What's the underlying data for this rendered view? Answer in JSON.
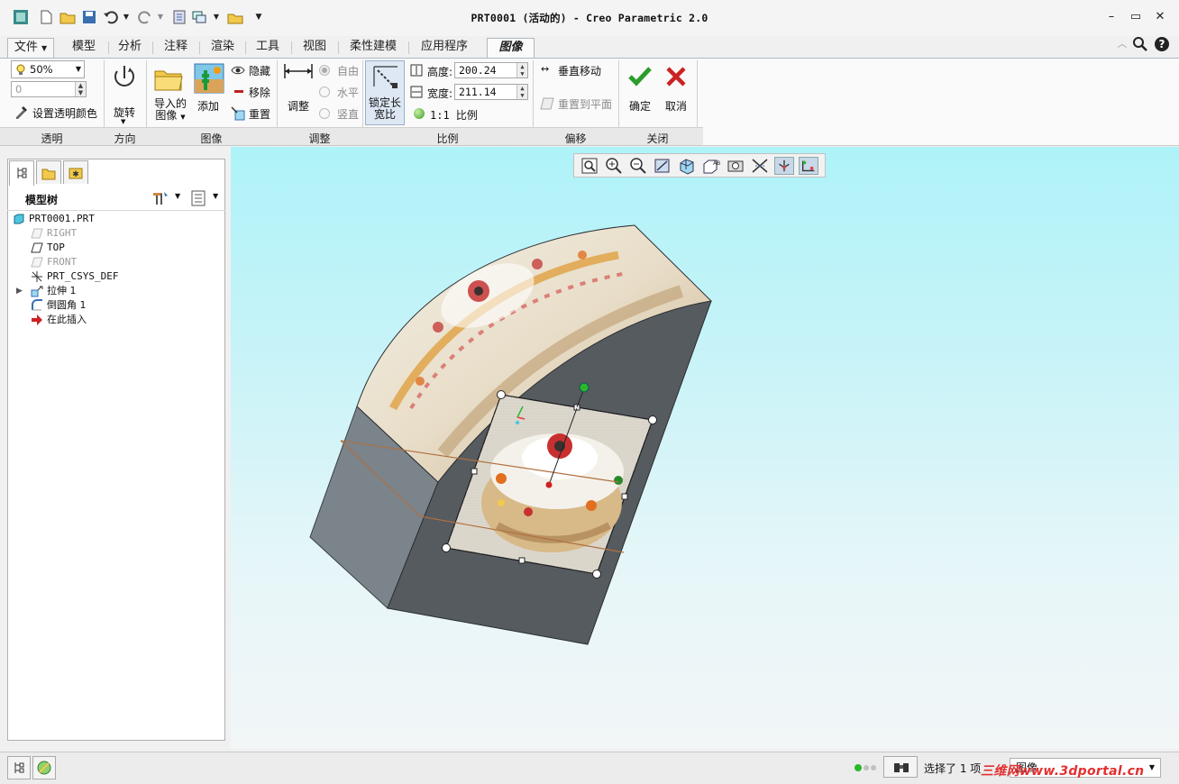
{
  "window": {
    "title": "PRT0001 (活动的) - Creo Parametric 2.0"
  },
  "tabs": [
    {
      "label": "文件"
    },
    {
      "label": "模型"
    },
    {
      "label": "分析"
    },
    {
      "label": "注释"
    },
    {
      "label": "渲染"
    },
    {
      "label": "工具"
    },
    {
      "label": "视图"
    },
    {
      "label": "柔性建模"
    },
    {
      "label": "应用程序"
    },
    {
      "label": "图像"
    }
  ],
  "active_tab": "图像",
  "ribbon": {
    "transparency": {
      "value": "50%",
      "number_field": "0",
      "set_color_label": "设置透明颜色",
      "group_label": "透明"
    },
    "orientation": {
      "rotate_label": "旋转",
      "group_label": "方向"
    },
    "image": {
      "imported_label_line1": "导入的",
      "imported_label_line2": "图像",
      "add_label": "添加",
      "hide_label": "隐藏",
      "remove_label": "移除",
      "reset_label": "重置",
      "group_label": "图像"
    },
    "adjust": {
      "adjust_label": "调整",
      "free_label": "自由",
      "horizontal_label": "水平",
      "vertical_label": "竖直",
      "group_label": "调整"
    },
    "scale": {
      "lock_label_line1": "锁定长",
      "lock_label_line2": "宽比",
      "height_label": "高度:",
      "height_value": "200.24",
      "width_label": "宽度:",
      "width_value": "211.14",
      "ratio_label": "1:1 比例",
      "group_label": "比例"
    },
    "offset": {
      "vertical_move_label": "垂直移动",
      "reset_to_plane_label": "重置到平面",
      "group_label": "偏移"
    },
    "close": {
      "ok_label": "确定",
      "cancel_label": "取消",
      "group_label": "关闭"
    }
  },
  "model_tree": {
    "title": "模型树",
    "items": [
      {
        "label": "PRT0001.PRT",
        "icon": "part-icon",
        "dim": false
      },
      {
        "label": "RIGHT",
        "icon": "datum-plane-icon",
        "dim": true
      },
      {
        "label": "TOP",
        "icon": "datum-plane-icon",
        "dim": false
      },
      {
        "label": "FRONT",
        "icon": "datum-plane-icon",
        "dim": true
      },
      {
        "label": "PRT_CSYS_DEF",
        "icon": "csys-icon",
        "dim": false
      },
      {
        "label": "拉伸 1",
        "icon": "extrude-icon",
        "dim": false
      },
      {
        "label": "倒圆角 1",
        "icon": "round-icon",
        "dim": false
      },
      {
        "label": "在此插入",
        "icon": "insert-here-icon",
        "dim": false
      }
    ]
  },
  "status_bar": {
    "selection_text": "选择了 1 项",
    "filter_value": "图像"
  },
  "watermark": "三维网www.3dportal.cn",
  "colors": {
    "ok_green": "#2a9d2a",
    "cancel_red": "#cc2222",
    "viewport_top": "#aef3f9",
    "model_gray": "#5a6066"
  }
}
